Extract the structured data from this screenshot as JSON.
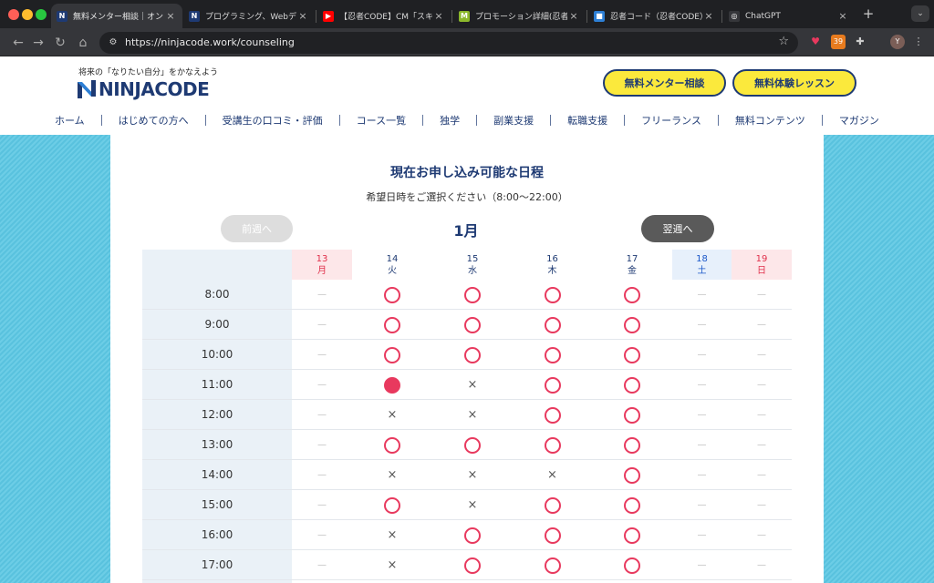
{
  "browser": {
    "tabs": [
      {
        "title": "無料メンター相談｜オンラ",
        "fav_color": "#1e3a73",
        "fav_text": "N",
        "active": true
      },
      {
        "title": "プログラミング、Webデザ",
        "fav_color": "#1e3a73",
        "fav_text": "N",
        "active": false
      },
      {
        "title": "【忍者CODE】CM「スキ",
        "fav_color": "#ff0000",
        "fav_text": "▶",
        "active": false
      },
      {
        "title": "プロモーション詳細(忍者C",
        "fav_color": "#8cb82c",
        "fav_text": "M",
        "active": false
      },
      {
        "title": "忍者コード（忍者CODE）",
        "fav_color": "#2d7fd5",
        "fav_text": "■",
        "active": false
      },
      {
        "title": "ChatGPT",
        "fav_color": "#35363a",
        "fav_text": "◎",
        "active": false
      }
    ],
    "url": "https://ninjacode.work/counseling",
    "profile_initial": "Y",
    "ext_badge": "39"
  },
  "site": {
    "tagline": "将来の「なりたい自分」をかなえよう",
    "logo_text": "NINJACODE",
    "cta_mentor": "無料メンター相談",
    "cta_trial": "無料体験レッスン",
    "nav": [
      "ホーム",
      "はじめての方へ",
      "受講生の口コミ・評価",
      "コース一覧",
      "独学",
      "副業支援",
      "転職支援",
      "フリーランス",
      "無料コンテンツ",
      "マガジン"
    ]
  },
  "schedule": {
    "title": "現在お申し込み可能な日程",
    "subtitle": "希望日時をご選択ください（8:00〜22:00）",
    "prev_week": "前週へ",
    "next_week": "翌週へ",
    "month": "1月",
    "days": [
      {
        "date": "13",
        "weekday": "月",
        "kind": "mon"
      },
      {
        "date": "14",
        "weekday": "火",
        "kind": "weekday"
      },
      {
        "date": "15",
        "weekday": "水",
        "kind": "weekday"
      },
      {
        "date": "16",
        "weekday": "木",
        "kind": "weekday"
      },
      {
        "date": "17",
        "weekday": "金",
        "kind": "weekday"
      },
      {
        "date": "18",
        "weekday": "土",
        "kind": "sat"
      },
      {
        "date": "19",
        "weekday": "日",
        "kind": "sun"
      }
    ],
    "rows": [
      {
        "time": "8:00",
        "slots": [
          "-",
          "o",
          "o",
          "o",
          "o",
          "-",
          "-"
        ]
      },
      {
        "time": "9:00",
        "slots": [
          "-",
          "o",
          "o",
          "o",
          "o",
          "-",
          "-"
        ]
      },
      {
        "time": "10:00",
        "slots": [
          "-",
          "o",
          "o",
          "o",
          "o",
          "-",
          "-"
        ]
      },
      {
        "time": "11:00",
        "slots": [
          "-",
          "selected",
          "x",
          "o",
          "o",
          "-",
          "-"
        ]
      },
      {
        "time": "12:00",
        "slots": [
          "-",
          "x",
          "x",
          "o",
          "o",
          "-",
          "-"
        ]
      },
      {
        "time": "13:00",
        "slots": [
          "-",
          "o",
          "o",
          "o",
          "o",
          "-",
          "-"
        ]
      },
      {
        "time": "14:00",
        "slots": [
          "-",
          "x",
          "x",
          "x",
          "o",
          "-",
          "-"
        ]
      },
      {
        "time": "15:00",
        "slots": [
          "-",
          "o",
          "x",
          "o",
          "o",
          "-",
          "-"
        ]
      },
      {
        "time": "16:00",
        "slots": [
          "-",
          "x",
          "o",
          "o",
          "o",
          "-",
          "-"
        ]
      },
      {
        "time": "17:00",
        "slots": [
          "-",
          "x",
          "o",
          "o",
          "o",
          "-",
          "-"
        ]
      }
    ],
    "symbols": {
      "dash": "—",
      "cross": "×"
    },
    "colors": {
      "accent": "#e8395e",
      "navy": "#1e3a73",
      "cta_yellow": "#fbe93c"
    }
  }
}
